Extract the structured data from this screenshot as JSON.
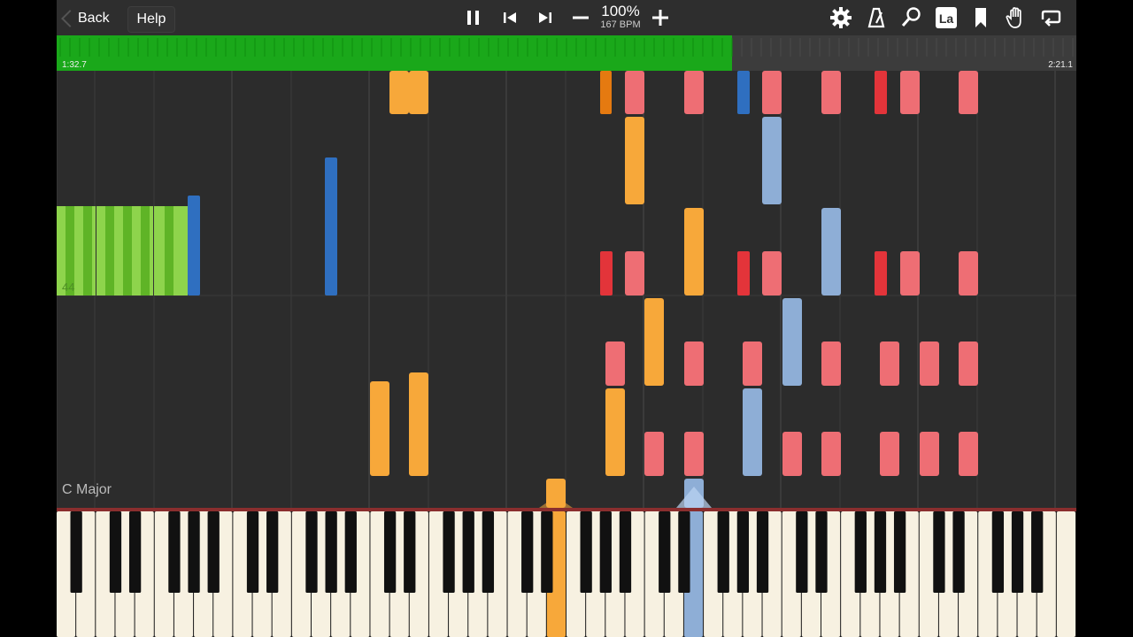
{
  "toolbar": {
    "back_label": "Back",
    "help_label": "Help",
    "tempo_percent": "100%",
    "tempo_bpm": "167 BPM",
    "lesson_badge": "La"
  },
  "icons": [
    "chevron-left-icon",
    "pause-icon",
    "skip-back-icon",
    "skip-forward-icon",
    "minus-icon",
    "plus-icon",
    "gear-icon",
    "metronome-icon",
    "magnifier-icon",
    "la-label-icon",
    "bookmark-icon",
    "hand-icon",
    "loop-icon"
  ],
  "playback": {
    "current_time": "1:32.7",
    "total_time": "2:21.1",
    "progress": 0.6625
  },
  "roll": {
    "key_signature": "C Major",
    "measure_number": "44"
  },
  "colors": {
    "accent_green": "#1aa81a",
    "orange": "#f7a83a",
    "dark_orange": "#e57a10",
    "pink": "#ee6e74",
    "red": "#e3343a",
    "blue": "#2f6fc0",
    "light_blue": "#8eaed6",
    "lime": "#8ed44c"
  }
}
